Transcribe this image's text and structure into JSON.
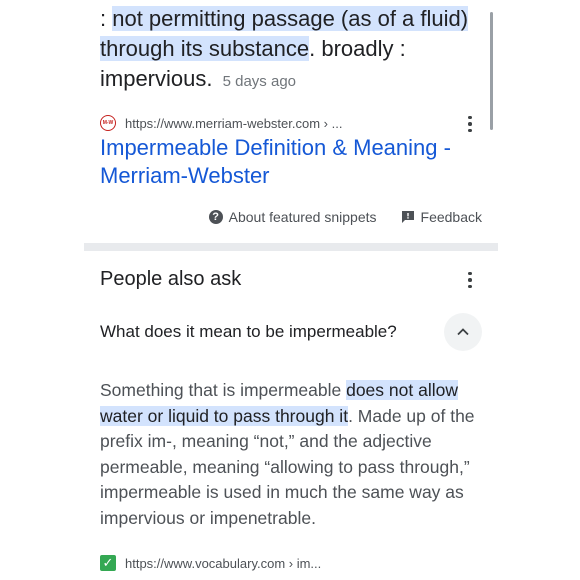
{
  "snippet": {
    "prefix": ": ",
    "highlight_1": "not permitting passage (as of a fluid) through its substance",
    "rest": ". broadly : impervious.",
    "date": "5 days ago"
  },
  "source": {
    "favicon_text": "M-W",
    "url": "https://www.merriam-webster.com › ...",
    "title": "Impermeable Definition & Meaning - Merriam-Webster"
  },
  "snippet_footer": {
    "about_label": "About featured snippets",
    "feedback_label": "Feedback"
  },
  "people_also_ask": {
    "title": "People also ask",
    "question": "What does it mean to be impermeable?",
    "answer_prefix": "Something that is impermeable ",
    "answer_highlight": "does not allow water or liquid to pass through it",
    "answer_rest": ". Made up of the prefix im-, meaning “not,” and the adjective permeable, meaning “allowing to pass through,” impermeable is used in much the same way as impervious or impenetrable.",
    "source_url": "https://www.vocabulary.com › im..."
  },
  "colors": {
    "link": "#1558d6",
    "highlight": "#d3e3fd",
    "divider": "#e8eaed",
    "check": "#34a853"
  }
}
